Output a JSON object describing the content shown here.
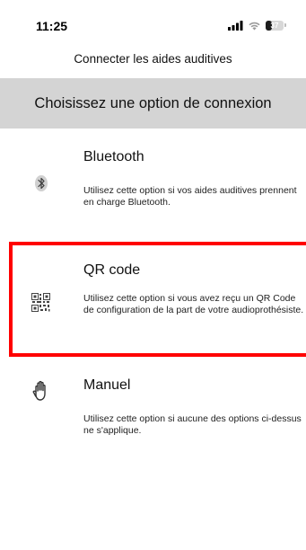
{
  "status_bar": {
    "time": "11:25",
    "signal_icon": "signal-bars-icon",
    "wifi_icon": "wifi-icon",
    "battery_level": "37"
  },
  "nav": {
    "title": "Connecter les aides auditives"
  },
  "section": {
    "header": "Choisissez une option de connexion"
  },
  "options": [
    {
      "title": "Bluetooth",
      "description": "Utilisez cette option si vos aides auditives prennent en charge Bluetooth.",
      "icon": "bluetooth-icon"
    },
    {
      "title": "QR code",
      "description": "Utilisez cette option si vous avez reçu un QR Code de configuration de la part de votre audioprothésiste.",
      "icon": "qr-code-icon"
    },
    {
      "title": "Manuel",
      "description": "Utilisez cette option si aucune des options ci-dessus ne s'applique.",
      "icon": "hand-icon"
    }
  ],
  "colors": {
    "section_header_bg": "#d4d4d4",
    "highlight_border": "#ff0000",
    "background": "#ffffff"
  }
}
